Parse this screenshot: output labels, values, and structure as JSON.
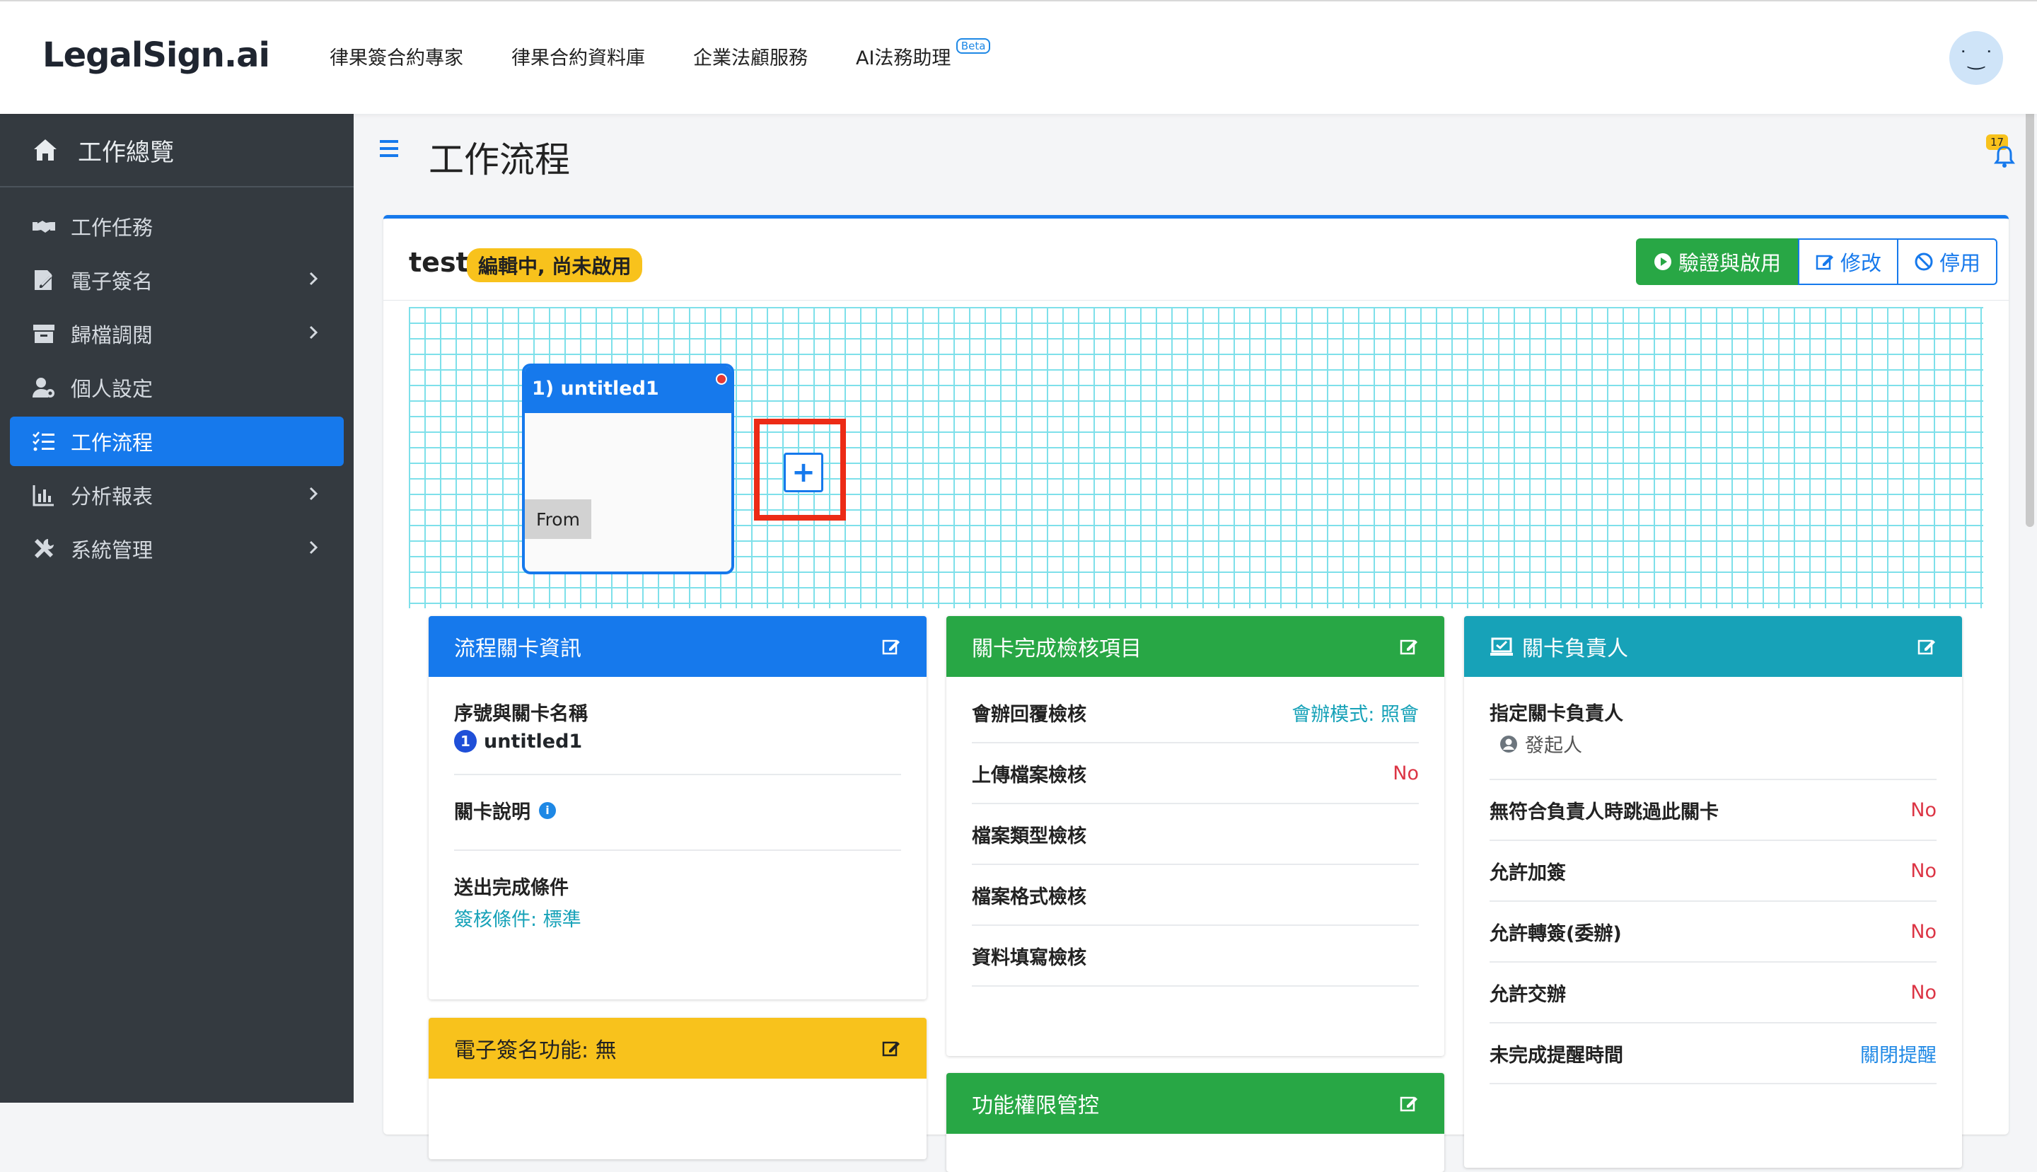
{
  "app": {
    "logo": "LegalSign.ai"
  },
  "topnav": [
    {
      "label": "律果簽合約專家"
    },
    {
      "label": "律果合約資料庫"
    },
    {
      "label": "企業法顧服務"
    },
    {
      "label": "AI法務助理",
      "badge": "Beta"
    }
  ],
  "avatar": {
    "face": "˙‿˙"
  },
  "sidebar": {
    "home": "工作總覽",
    "items": [
      {
        "label": "工作任務",
        "icon": "handshake-icon",
        "chevron": false
      },
      {
        "label": "電子簽名",
        "icon": "signature-icon",
        "chevron": true
      },
      {
        "label": "歸檔調閱",
        "icon": "archive-icon",
        "chevron": true
      },
      {
        "label": "個人設定",
        "icon": "user-gear-icon",
        "chevron": false
      },
      {
        "label": "工作流程",
        "icon": "list-check-icon",
        "chevron": false,
        "active": true
      },
      {
        "label": "分析報表",
        "icon": "chart-icon",
        "chevron": true
      },
      {
        "label": "系統管理",
        "icon": "tools-icon",
        "chevron": true
      }
    ]
  },
  "page": {
    "title": "工作流程",
    "notification_count": "17"
  },
  "workflow": {
    "name": "test",
    "status": "編輯中, 尚未啟用",
    "buttons": {
      "verify": "驗證與啟用",
      "edit": "修改",
      "disable": "停用"
    },
    "node": {
      "title": "1) untitled1",
      "from": "From"
    },
    "add_symbol": "+"
  },
  "panel_stage_info": {
    "title": "流程關卡資訊",
    "seq_label": "序號與關卡名稱",
    "seq_num": "1",
    "seq_name": "untitled1",
    "desc_label": "關卡說明",
    "desc_info": "i",
    "submit_label": "送出完成條件",
    "submit_value": "簽核條件: 標準"
  },
  "panel_esign": {
    "title": "電子簽名功能: 無"
  },
  "panel_checks": {
    "title": "關卡完成檢核項目",
    "rows": [
      {
        "label": "會辦回覆檢核",
        "value": "會辦模式: 照會"
      },
      {
        "label": "上傳檔案檢核",
        "value": "No"
      },
      {
        "label": "檔案類型檢核",
        "value": ""
      },
      {
        "label": "檔案格式檢核",
        "value": ""
      },
      {
        "label": "資料填寫檢核",
        "value": ""
      }
    ]
  },
  "panel_permissions": {
    "title": "功能權限管控"
  },
  "panel_owner": {
    "title": "關卡負責人",
    "assign_label": "指定關卡負責人",
    "assign_value": "發起人",
    "rows": [
      {
        "label": "無符合負責人時跳過此關卡",
        "value": "No"
      },
      {
        "label": "允許加簽",
        "value": "No"
      },
      {
        "label": "允許轉簽(委辦)",
        "value": "No"
      },
      {
        "label": "允許交辦",
        "value": "No"
      },
      {
        "label": "未完成提醒時間",
        "value": "關閉提醒"
      }
    ]
  },
  "colors": {
    "primary": "#1679ec",
    "success": "#28a745",
    "info": "#17a2b8",
    "warning": "#f8c21c",
    "danger": "#dc3545",
    "sidebar": "#343a40",
    "highlight": "#ec2b16"
  }
}
